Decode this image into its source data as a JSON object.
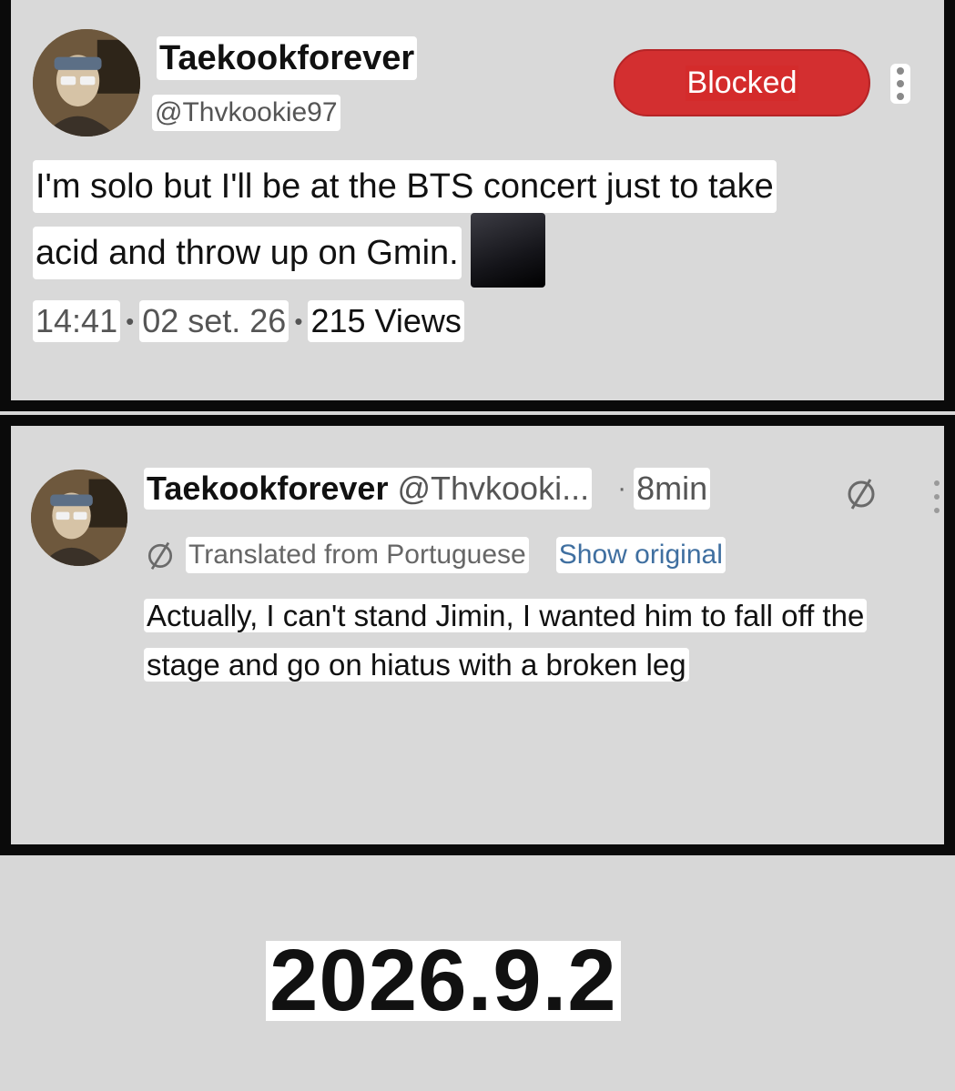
{
  "post": {
    "display_name": "Taekookforever",
    "handle": "@Thvkookie97",
    "block_button_label": "Blocked",
    "text_line1": "I'm solo but I'll be at the BTS concert just to take",
    "text_line2": "acid and throw up on Gmin.",
    "time": "14:41",
    "date": "02 set. 26",
    "views": "215 Views",
    "separator": "•"
  },
  "reply": {
    "display_name": "Taekookforever",
    "handle": "@Thvkooki...",
    "separator": "·",
    "elapsed": "8min",
    "translated_label": "Translated from Portuguese",
    "show_original_label": "Show original",
    "text_line1": "Actually, I can't stand Jimin, I wanted him to fall off the",
    "text_line2": "stage and go on hiatus with a broken leg"
  },
  "footer": {
    "date": "2026.9.2"
  },
  "colors": {
    "background": "#d7d7d7",
    "panel_border": "#0a0a0a",
    "blocked_button": "#d32f30",
    "link": "#3f6fa0"
  },
  "icons": {
    "more": "kebab-vertical-icon",
    "translate": "globe-slash-icon",
    "emoji": "black-square-emoji"
  }
}
